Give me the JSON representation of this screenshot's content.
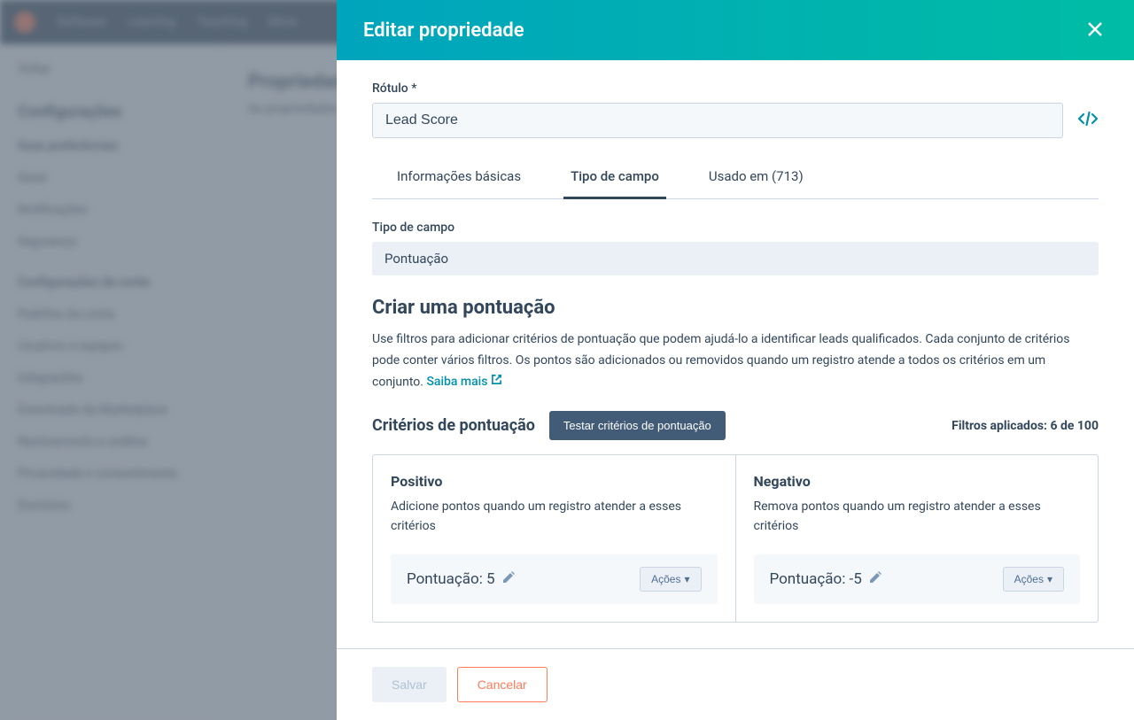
{
  "bg": {
    "nav": [
      "Software",
      "Learning",
      "Teaching",
      "More"
    ],
    "back": "Voltar",
    "config": "Configurações",
    "prefs": "Suas preferências",
    "items1": [
      "Geral",
      "Notificações",
      "Segurança"
    ],
    "section2": "Configurações da conta",
    "items2": [
      "Padrões da conta",
      "Usuários e equipes",
      "Integrações",
      "Downloads da Marketplace",
      "Rastreamento e análise",
      "Privacidade e consentimento",
      "Domínios"
    ],
    "mainTitle": "Propriedades",
    "mainText": "As propriedades são usadas para coletar e armazenar informações"
  },
  "modal": {
    "title": "Editar propriedade",
    "labelField": "Rótulo *",
    "labelValue": "Lead Score",
    "tabs": {
      "basic": "Informações básicas",
      "fieldType": "Tipo de campo",
      "usedIn": "Usado em (713)"
    },
    "fieldTypeLabel": "Tipo de campo",
    "fieldTypeValue": "Pontuação",
    "createScoreTitle": "Criar uma pontuação",
    "createScoreDesc": "Use filtros para adicionar critérios de pontuação que podem ajudá-lo a identificar leads qualificados. Cada conjunto de critérios pode conter vários filtros. Os pontos são adicionados ou removidos quando um registro atende a todos os critérios em um conjunto. ",
    "learnMore": "Saiba mais",
    "criteriaTitle": "Critérios de pontuação",
    "testBtn": "Testar critérios de pontuação",
    "filtersApplied": "Filtros aplicados: 6 de 100",
    "positive": {
      "title": "Positivo",
      "desc": "Adicione pontos quando um registro atender a esses critérios",
      "score": "Pontuação: 5",
      "actions": "Ações"
    },
    "negative": {
      "title": "Negativo",
      "desc": "Remova pontos quando um registro atender a esses critérios",
      "score": "Pontuação: -5",
      "actions": "Ações"
    },
    "save": "Salvar",
    "cancel": "Cancelar"
  }
}
